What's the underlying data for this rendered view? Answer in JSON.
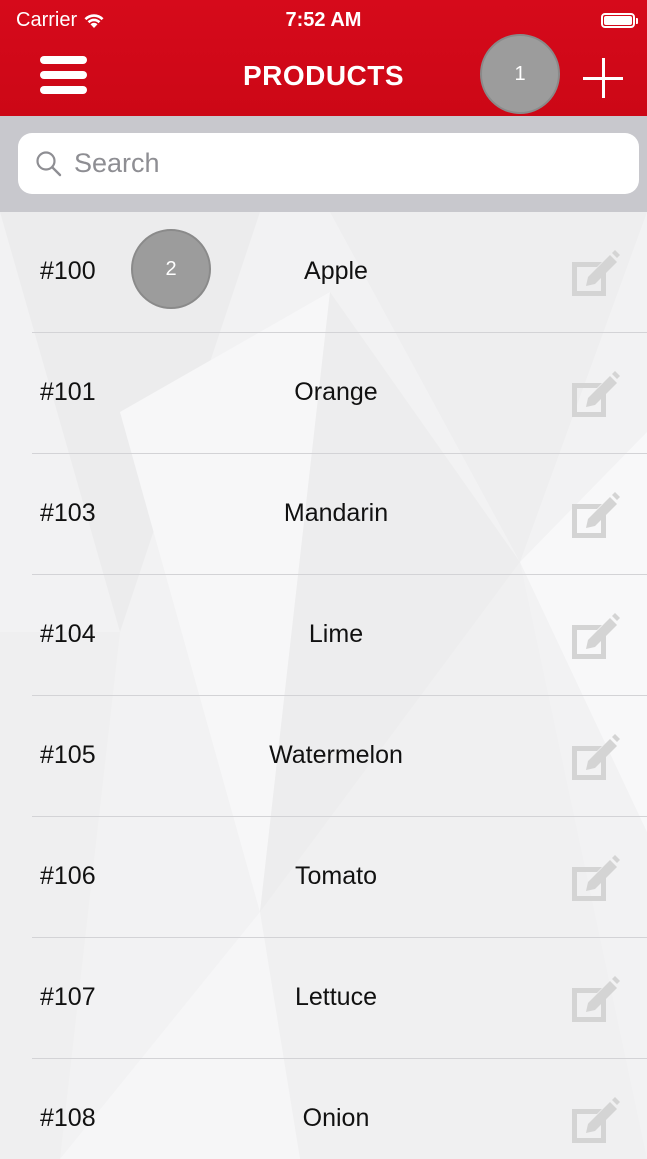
{
  "status_bar": {
    "carrier": "Carrier",
    "time": "7:52 AM"
  },
  "header": {
    "title": "PRODUCTS",
    "menu_icon": "hamburger-menu-icon",
    "add_icon": "plus-icon"
  },
  "markers": {
    "first": "1",
    "second": "2"
  },
  "search": {
    "placeholder": "Search",
    "value": ""
  },
  "products": [
    {
      "id": "#100",
      "name": "Apple"
    },
    {
      "id": "#101",
      "name": "Orange"
    },
    {
      "id": "#103",
      "name": "Mandarin"
    },
    {
      "id": "#104",
      "name": "Lime"
    },
    {
      "id": "#105",
      "name": "Watermelon"
    },
    {
      "id": "#106",
      "name": "Tomato"
    },
    {
      "id": "#107",
      "name": "Lettuce"
    },
    {
      "id": "#108",
      "name": "Onion"
    }
  ],
  "colors": {
    "header_red": "#d60a1b",
    "search_bar_background": "#c8c8cd",
    "edit_icon": "#d4d4d4",
    "marker": "#9c9c9c"
  }
}
